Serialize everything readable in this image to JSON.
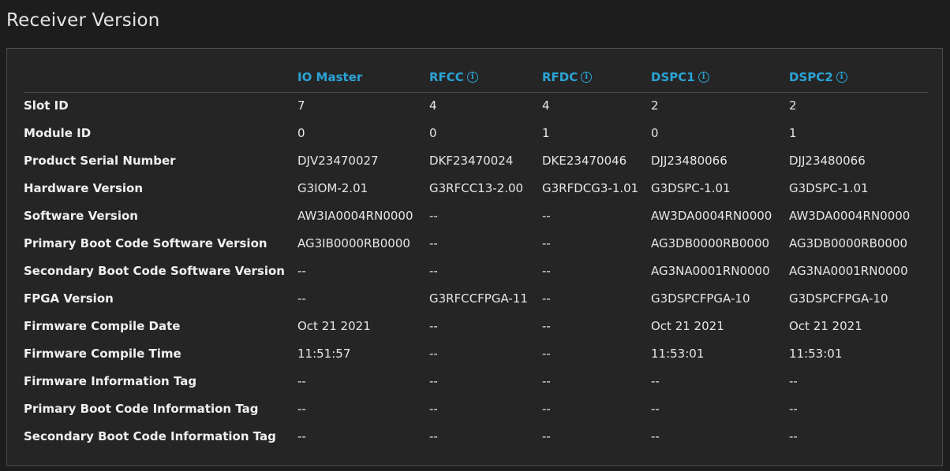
{
  "page": {
    "title": "Receiver Version"
  },
  "table": {
    "columns": [
      {
        "label": "",
        "has_info": false
      },
      {
        "label": "IO Master",
        "has_info": false
      },
      {
        "label": "RFCC",
        "has_info": true
      },
      {
        "label": "RFDC",
        "has_info": true
      },
      {
        "label": "DSPC1",
        "has_info": true
      },
      {
        "label": "DSPC2",
        "has_info": true
      }
    ],
    "rows": [
      {
        "label": "Slot ID",
        "values": [
          "7",
          "4",
          "4",
          "2",
          "2"
        ]
      },
      {
        "label": "Module ID",
        "values": [
          "0",
          "0",
          "1",
          "0",
          "1"
        ]
      },
      {
        "label": "Product Serial Number",
        "values": [
          "DJV23470027",
          "DKF23470024",
          "DKE23470046",
          "DJJ23480066",
          "DJJ23480066"
        ]
      },
      {
        "label": "Hardware Version",
        "values": [
          "G3IOM-2.01",
          "G3RFCC13-2.00",
          "G3RFDCG3-1.01",
          "G3DSPC-1.01",
          "G3DSPC-1.01"
        ]
      },
      {
        "label": "Software Version",
        "values": [
          "AW3IA0004RN0000",
          "--",
          "--",
          "AW3DA0004RN0000",
          "AW3DA0004RN0000"
        ]
      },
      {
        "label": "Primary Boot Code Software Version",
        "values": [
          "AG3IB0000RB0000",
          "--",
          "--",
          "AG3DB0000RB0000",
          "AG3DB0000RB0000"
        ]
      },
      {
        "label": "Secondary Boot Code Software Version",
        "values": [
          "--",
          "--",
          "--",
          "AG3NA0001RN0000",
          "AG3NA0001RN0000"
        ]
      },
      {
        "label": "FPGA Version",
        "values": [
          "--",
          "G3RFCCFPGA-11",
          "--",
          "G3DSPCFPGA-10",
          "G3DSPCFPGA-10"
        ]
      },
      {
        "label": "Firmware Compile Date",
        "values": [
          "Oct 21 2021",
          "--",
          "--",
          "Oct 21 2021",
          "Oct 21 2021"
        ]
      },
      {
        "label": "Firmware Compile Time",
        "values": [
          "11:51:57",
          "--",
          "--",
          "11:53:01",
          "11:53:01"
        ]
      },
      {
        "label": "Firmware Information Tag",
        "values": [
          "--",
          "--",
          "--",
          "--",
          "--"
        ]
      },
      {
        "label": "Primary Boot Code Information Tag",
        "values": [
          "--",
          "--",
          "--",
          "--",
          "--"
        ]
      },
      {
        "label": "Secondary Boot Code Information Tag",
        "values": [
          "--",
          "--",
          "--",
          "--",
          "--"
        ]
      }
    ]
  },
  "icons": {
    "info": "info-icon"
  },
  "colors": {
    "accent": "#2ba3d6",
    "background": "#1d1d1d",
    "panel": "#252525"
  }
}
